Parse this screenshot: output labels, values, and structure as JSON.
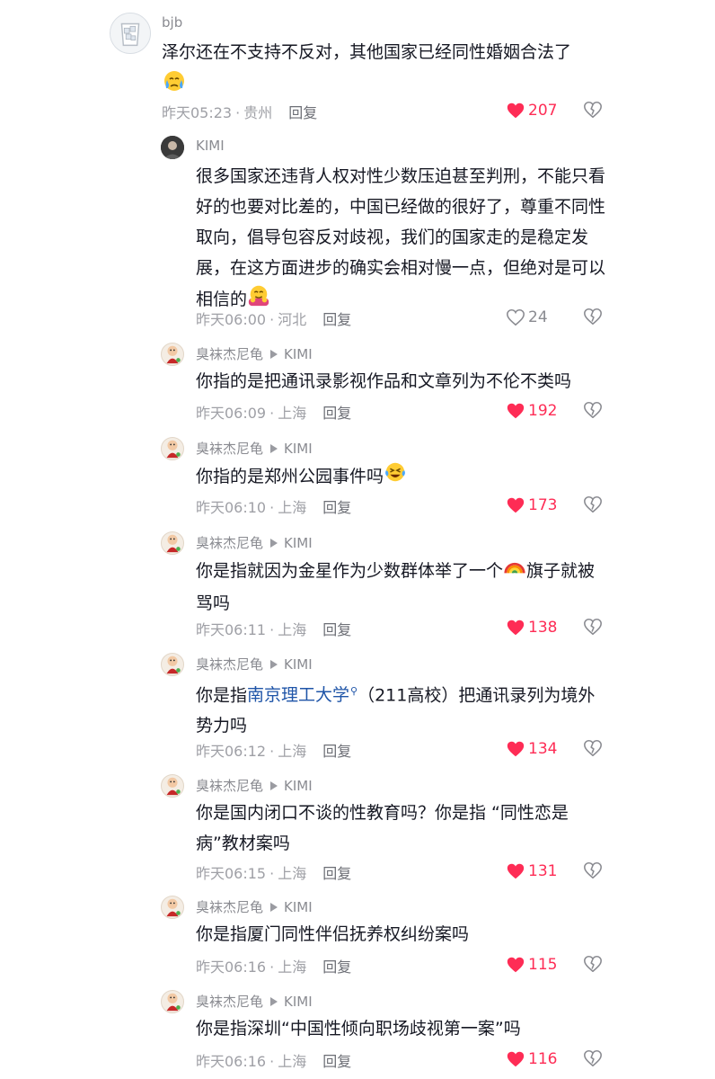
{
  "comments": [
    {
      "user": "bjb",
      "text": "泽尔还在不支持不反对，其他国家已经同性婚姻合法了",
      "time": "昨天05:23",
      "location": "贵州",
      "reply": "回复",
      "likes": "207",
      "liked": true,
      "avatar_icon": "ice-cup-avatar",
      "emoji": "crying-face"
    },
    {
      "user": "KIMI",
      "text": "很多国家还违背人权对性少数压迫甚至判刑，不能只看好的也要对比差的，中国已经做的很好了，尊重不同性取向，倡导包容反对歧视，我们的国家走的是稳定发展，在这方面进步的确实会相对慢一点，但绝对是可以相信的",
      "time": "昨天06:00",
      "location": "河北",
      "reply": "回复",
      "likes": "24",
      "liked": false,
      "emoji": "hugging-face"
    },
    {
      "user": "臭袜杰尼龟",
      "reply_to": "KIMI",
      "text": "你指的是把通讯录影视作品和文章列为不伦不类吗",
      "time": "昨天06:09",
      "location": "上海",
      "reply": "回复",
      "likes": "192",
      "liked": true
    },
    {
      "user": "臭袜杰尼龟",
      "reply_to": "KIMI",
      "text": "你指的是郑州公园事件吗",
      "time": "昨天06:10",
      "location": "上海",
      "reply": "回复",
      "likes": "173",
      "liked": true,
      "emoji": "laughing-crying-face"
    },
    {
      "user": "臭袜杰尼龟",
      "reply_to": "KIMI",
      "text_before": "你是指就因为金星作为少数群体举了一个",
      "text_after": "旗子就被骂吗",
      "time": "昨天06:11",
      "location": "上海",
      "reply": "回复",
      "likes": "138",
      "liked": true,
      "emoji": "rainbow"
    },
    {
      "user": "臭袜杰尼龟",
      "reply_to": "KIMI",
      "text_before": "你是指",
      "link": "南京理工大学",
      "text_after": "（211高校）把通讯录列为境外势力吗",
      "time": "昨天06:12",
      "location": "上海",
      "reply": "回复",
      "likes": "134",
      "liked": true
    },
    {
      "user": "臭袜杰尼龟",
      "reply_to": "KIMI",
      "text": "你是国内闭口不谈的性教育吗？你是指 “同性恋是病”教材案吗",
      "time": "昨天06:15",
      "location": "上海",
      "reply": "回复",
      "likes": "131",
      "liked": true
    },
    {
      "user": "臭袜杰尼龟",
      "reply_to": "KIMI",
      "text": "你是指厦门同性伴侣抚养权纠纷案吗",
      "time": "昨天06:16",
      "location": "上海",
      "reply": "回复",
      "likes": "115",
      "liked": true
    },
    {
      "user": "臭袜杰尼龟",
      "reply_to": "KIMI",
      "text": "你是指深圳“中国性倾向职场歧视第一案”吗",
      "time": "昨天06:16",
      "location": "上海",
      "reply": "回复",
      "likes": "116",
      "liked": true
    }
  ],
  "colors": {
    "like_active": "#fe2c55",
    "meta_gray": "#9fa0a6",
    "link_blue": "#1f55a8"
  },
  "icons": {
    "like": "heart-icon",
    "dislike": "broken-heart-icon",
    "reply_arrow": "play-arrow-icon",
    "link_search": "search-icon"
  }
}
